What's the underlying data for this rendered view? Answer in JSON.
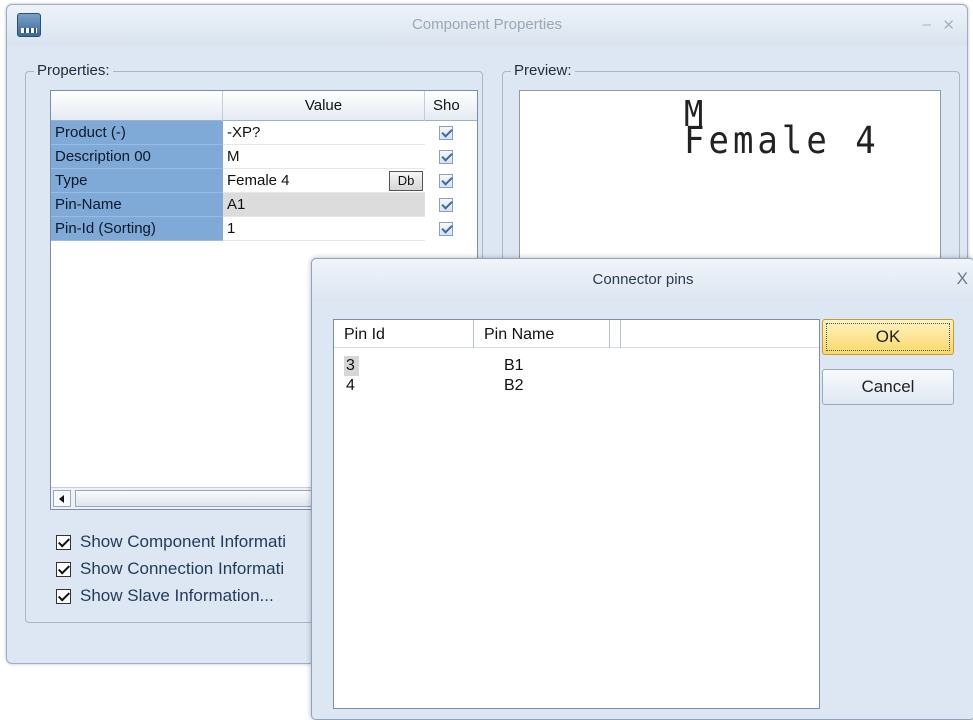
{
  "main_window": {
    "title": "Component Properties",
    "minimize_glyph": "–",
    "close_glyph": "✕"
  },
  "properties": {
    "group_label": "Properties:",
    "columns": {
      "name": "",
      "value": "Value",
      "show": "Sho"
    },
    "rows": [
      {
        "name": "Product (-)",
        "value": "-XP?",
        "show": true
      },
      {
        "name": "Description 00",
        "value": "M",
        "show": true
      },
      {
        "name": "Type",
        "value": "Female 4",
        "show": true,
        "button": "Db"
      },
      {
        "name": "Pin-Name",
        "value": "A1",
        "show": true,
        "selected": true
      },
      {
        "name": "Pin-Id (Sorting)",
        "value": "1",
        "show": true
      }
    ],
    "options": [
      {
        "label": "Show Component Informati",
        "checked": true
      },
      {
        "label": "Show Connection Informati",
        "checked": true
      },
      {
        "label": "Show Slave Information...",
        "checked": true
      }
    ]
  },
  "preview": {
    "group_label": "Preview:",
    "line1": "M",
    "line2": "Female 4"
  },
  "connector_pins": {
    "title": "Connector pins",
    "close_glyph": "X",
    "columns": {
      "pin_id": "Pin Id",
      "pin_name": "Pin Name"
    },
    "rows": [
      {
        "pin_id": "3",
        "pin_name": "B1",
        "selected": true
      },
      {
        "pin_id": "4",
        "pin_name": "B2"
      }
    ],
    "ok_label": "OK",
    "cancel_label": "Cancel"
  }
}
